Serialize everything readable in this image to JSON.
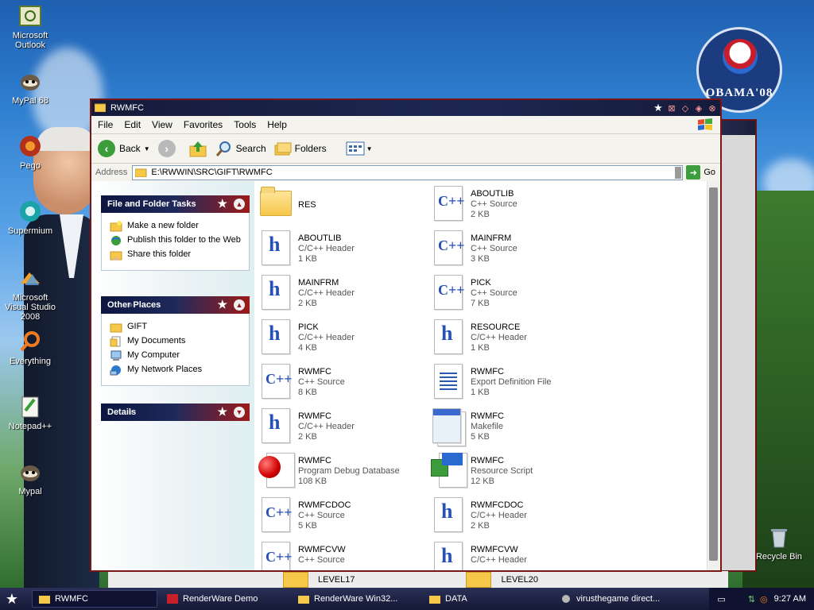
{
  "desktop_icons": [
    {
      "label": "Microsoft Outlook",
      "icon": "outlook-icon"
    },
    {
      "label": "MyPal 68",
      "icon": "raccoon-icon"
    },
    {
      "label": "Pego",
      "icon": "pego-icon"
    },
    {
      "label": "Supermium",
      "icon": "supermium-icon"
    },
    {
      "label": "Microsoft Visual Studio 2008",
      "icon": "visual-studio-icon"
    },
    {
      "label": "Everything",
      "icon": "search-ring-icon"
    },
    {
      "label": "Notepad++",
      "icon": "notepad-icon"
    },
    {
      "label": "Mypal",
      "icon": "raccoon-icon"
    },
    {
      "label": "Recycle Bin",
      "icon": "recycle-bin-icon"
    }
  ],
  "poster": {
    "text": "OBAMA'08"
  },
  "window": {
    "title": "RWMFC",
    "menu": [
      "File",
      "Edit",
      "View",
      "Favorites",
      "Tools",
      "Help"
    ],
    "toolbar": {
      "back": "Back",
      "search": "Search",
      "folders": "Folders"
    },
    "address": {
      "label": "Address",
      "value": "E:\\RWWIN\\SRC\\GIFT\\RWMFC",
      "go": "Go"
    },
    "panels": {
      "file_tasks": {
        "title": "File and Folder Tasks",
        "items": [
          "Make a new folder",
          "Publish this folder to the Web",
          "Share this folder"
        ]
      },
      "other_places": {
        "title": "Other Places",
        "items": [
          "GIFT",
          "My Documents",
          "My Computer",
          "My Network Places"
        ]
      },
      "details": {
        "title": "Details"
      }
    },
    "files": [
      {
        "name": "RES",
        "type": "",
        "size": "",
        "kind": "folder"
      },
      {
        "name": "ABOUTLIB",
        "type": "C++ Source",
        "size": "2 KB",
        "kind": "cpp"
      },
      {
        "name": "ABOUTLIB",
        "type": "C/C++ Header",
        "size": "1 KB",
        "kind": "h"
      },
      {
        "name": "MAINFRM",
        "type": "C++ Source",
        "size": "3 KB",
        "kind": "cpp"
      },
      {
        "name": "MAINFRM",
        "type": "C/C++ Header",
        "size": "2 KB",
        "kind": "h"
      },
      {
        "name": "PICK",
        "type": "C++ Source",
        "size": "7 KB",
        "kind": "cpp"
      },
      {
        "name": "PICK",
        "type": "C/C++ Header",
        "size": "4 KB",
        "kind": "h"
      },
      {
        "name": "RESOURCE",
        "type": "C/C++ Header",
        "size": "1 KB",
        "kind": "h"
      },
      {
        "name": "RWMFC",
        "type": "C++ Source",
        "size": "8 KB",
        "kind": "cpp"
      },
      {
        "name": "RWMFC",
        "type": "Export Definition File",
        "size": "1 KB",
        "kind": "def"
      },
      {
        "name": "RWMFC",
        "type": "C/C++ Header",
        "size": "2 KB",
        "kind": "h"
      },
      {
        "name": "RWMFC",
        "type": "Makefile",
        "size": "5 KB",
        "kind": "make"
      },
      {
        "name": "RWMFC",
        "type": "Program Debug Database",
        "size": "108 KB",
        "kind": "pdb"
      },
      {
        "name": "RWMFC",
        "type": "Resource Script",
        "size": "12 KB",
        "kind": "rc"
      },
      {
        "name": "RWMFCDOC",
        "type": "C++ Source",
        "size": "5 KB",
        "kind": "cpp"
      },
      {
        "name": "RWMFCDOC",
        "type": "C/C++ Header",
        "size": "2 KB",
        "kind": "h"
      },
      {
        "name": "RWMFCVW",
        "type": "C++ Source",
        "size": "",
        "kind": "cpp"
      },
      {
        "name": "RWMFCVW",
        "type": "C/C++ Header",
        "size": "",
        "kind": "h"
      }
    ]
  },
  "behind_window": {
    "items": [
      "LEVEL17",
      "LEVEL20"
    ]
  },
  "taskbar": {
    "items": [
      "RWMFC",
      "RenderWare Demo",
      "RenderWare Win32...",
      "DATA",
      "virusthegame direct..."
    ],
    "clock": "9:27 AM"
  }
}
